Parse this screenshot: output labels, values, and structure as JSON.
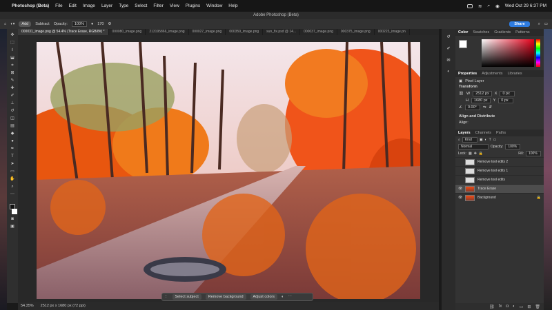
{
  "menubar": {
    "app_name": "Photoshop (Beta)",
    "items": [
      "File",
      "Edit",
      "Image",
      "Layer",
      "Type",
      "Select",
      "Filter",
      "View",
      "Plugins",
      "Window",
      "Help"
    ],
    "datetime": "Wed Oct 29 6:37 PM"
  },
  "window": {
    "title": "Adobe Photoshop (Beta)"
  },
  "options": {
    "add_label": "Add",
    "subtract_label": "Subtract",
    "opacity_label": "Opacity:",
    "opacity_value": "100%",
    "brush_size": "170",
    "share_label": "Share"
  },
  "tabs": [
    "000031_image.png @ 54.4% (Trace Erase, RGB/8#) *",
    "000080_image.png",
    "213195866_image.png",
    "000027_image.png",
    "000359_image.png",
    "sun_fix.psd @ 14...",
    "000037_image.png",
    "000375_image.png",
    "000223_image.pn"
  ],
  "context_bar": {
    "select_subject": "Select subject",
    "remove_background": "Remove background",
    "adjust_colors": "Adjust colors"
  },
  "status": {
    "zoom": "54.35%",
    "dimensions": "2512 px x 1680 px (72 ppi)"
  },
  "color_panel": {
    "tabs": [
      "Color",
      "Swatches",
      "Gradients",
      "Patterns"
    ]
  },
  "properties": {
    "tabs": [
      "Properties",
      "Adjustments",
      "Libraries"
    ],
    "layer_type": "Pixel Layer",
    "transform_title": "Transform",
    "w": "2512 px",
    "x": "0 px",
    "h": "1680 px",
    "y": "0 px",
    "angle": "0.00°",
    "align_title": "Align and Distribute",
    "align_label": "Align:"
  },
  "layers_panel": {
    "tabs": [
      "Layers",
      "Channels",
      "Paths"
    ],
    "kind_label": "Kind",
    "blend_mode": "Normal",
    "opacity_label": "Opacity:",
    "opacity_value": "100%",
    "lock_label": "Lock:",
    "fill_label": "Fill:",
    "fill_value": "100%",
    "layers": [
      {
        "name": "Remove tool edits 2",
        "visible": false,
        "selected": false
      },
      {
        "name": "Remove tool edits 1",
        "visible": false,
        "selected": false
      },
      {
        "name": "Remove tool edits",
        "visible": false,
        "selected": false
      },
      {
        "name": "Trace Erase",
        "visible": true,
        "selected": true
      },
      {
        "name": "Background",
        "visible": true,
        "selected": false
      }
    ]
  }
}
